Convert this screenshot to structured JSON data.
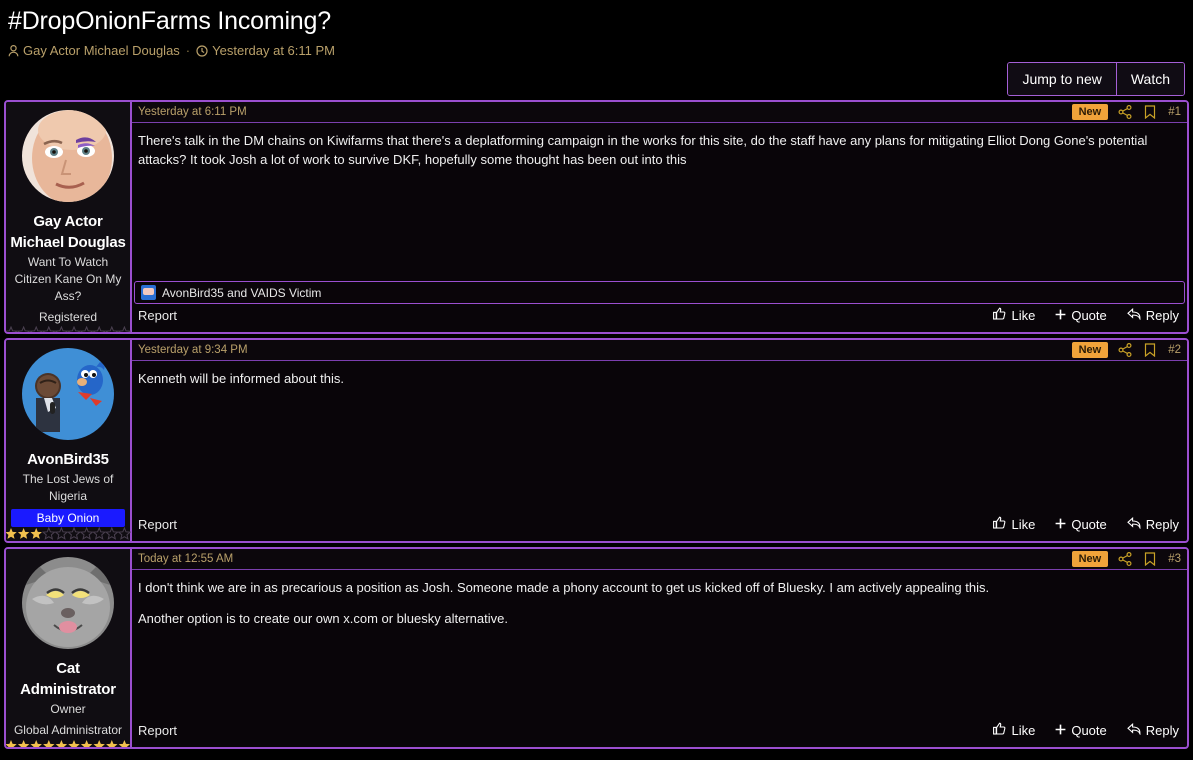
{
  "thread": {
    "title": "#DropOnionFarms Incoming?",
    "author": "Gay Actor Michael Douglas",
    "separator": "·",
    "date": "Yesterday at 6:11 PM"
  },
  "toolbar": {
    "jump_to_new": "Jump to new",
    "watch": "Watch"
  },
  "posts": [
    {
      "date": "Yesterday at 6:11 PM",
      "badge": "New",
      "number": "#1",
      "user": {
        "name": "Gay Actor Michael Douglas",
        "title": "Want To Watch Citizen Kane On My Ass?",
        "rank": "Registered",
        "banner": "",
        "stars_filled": 0,
        "stars_total": 10
      },
      "paragraphs": [
        "There's talk in the DM chains on Kiwifarms that there's a deplatforming campaign in the works for this site, do the staff have any plans for mitigating Elliot Dong Gone's potential attacks? It took Josh a lot of work to survive DKF, hopefully some thought has been out into this"
      ],
      "report": "Report",
      "like": "Like",
      "quote": "Quote",
      "reply": "Reply",
      "reactions": "AvonBird35 and VAIDS Victim"
    },
    {
      "date": "Yesterday at 9:34 PM",
      "badge": "New",
      "number": "#2",
      "user": {
        "name": "AvonBird35",
        "title": "The Lost Jews of Nigeria",
        "rank": "",
        "banner": "Baby Onion",
        "stars_filled": 3,
        "stars_total": 10
      },
      "paragraphs": [
        "Kenneth will be informed about this."
      ],
      "report": "Report",
      "like": "Like",
      "quote": "Quote",
      "reply": "Reply",
      "reactions": ""
    },
    {
      "date": "Today at 12:55 AM",
      "badge": "New",
      "number": "#3",
      "user": {
        "name": "Cat Administrator",
        "title": "Owner",
        "rank": "Global Administrator",
        "banner": "",
        "stars_filled": 10,
        "stars_total": 10
      },
      "paragraphs": [
        "I don't think we are in as precarious a position as Josh. Someone made a phony account to get us kicked off of Bluesky. I am actively appealing this.",
        "Another option is to create our own x.com or bluesky alternative."
      ],
      "report": "Report",
      "like": "Like",
      "quote": "Quote",
      "reply": "Reply",
      "reactions": ""
    }
  ],
  "colors": {
    "border_purple": "#9b4fd0",
    "meta_gold": "#b9a06a",
    "badge_orange": "#f0a33a",
    "banner_blue": "#1a1aff",
    "star_gold": "#f2c14e"
  }
}
